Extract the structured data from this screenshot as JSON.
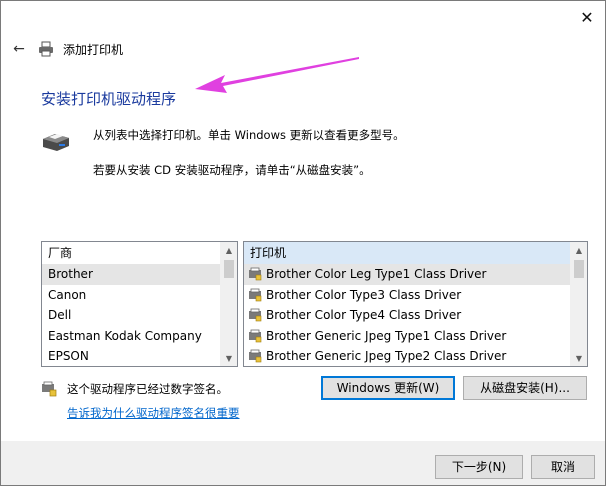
{
  "window": {
    "title": "添加打印机",
    "close_glyph": "✕"
  },
  "header": {
    "back_glyph": "←"
  },
  "heading": "安装打印机驱动程序",
  "description": {
    "line1": "从列表中选择打印机。单击 Windows 更新以查看更多型号。",
    "line2": "若要从安装 CD 安装驱动程序，请单击“从磁盘安装”。"
  },
  "manufacturers": {
    "header": "厂商",
    "items": [
      "Brother",
      "Canon",
      "Dell",
      "Eastman Kodak Company",
      "EPSON"
    ],
    "selected_index": 0
  },
  "printers": {
    "header": "打印机",
    "items": [
      "Brother Color Leg Type1 Class Driver",
      "Brother Color Type3 Class Driver",
      "Brother Color Type4 Class Driver",
      "Brother Generic Jpeg Type1 Class Driver",
      "Brother Generic Jpeg Type2 Class Driver"
    ],
    "selected_index": 0
  },
  "signature": {
    "text": "这个驱动程序已经过数字签名。",
    "link": "告诉我为什么驱动程序签名很重要"
  },
  "buttons": {
    "windows_update": "Windows 更新(W)",
    "from_disk": "从磁盘安装(H)...",
    "next": "下一步(N)",
    "cancel": "取消"
  },
  "colors": {
    "heading": "#1a3a9e",
    "link": "#0066cc",
    "annotation_arrow": "#e040e0",
    "focus_border": "#0078d7"
  }
}
